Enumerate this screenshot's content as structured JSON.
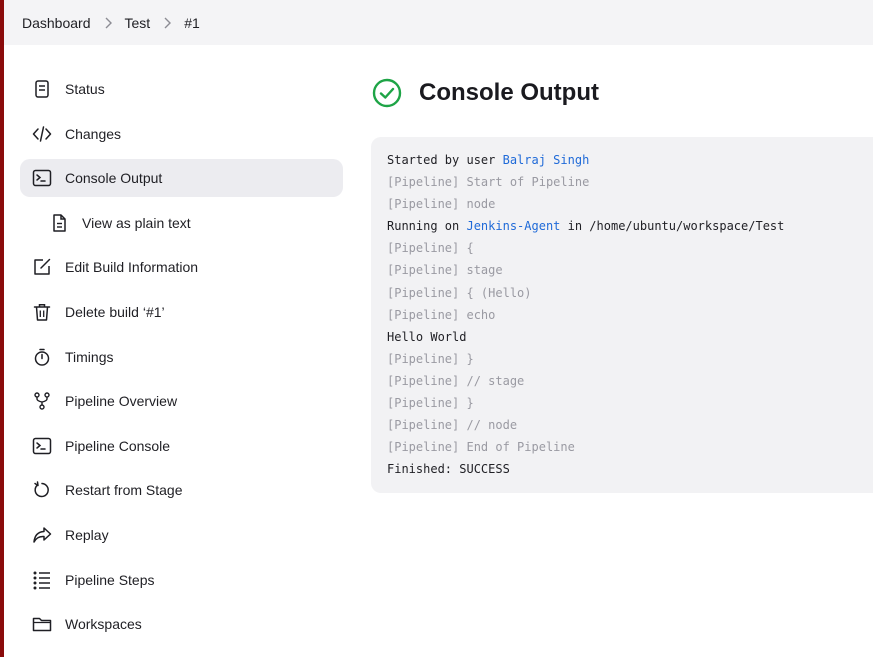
{
  "breadcrumb": [
    {
      "label": "Dashboard"
    },
    {
      "label": "Test"
    },
    {
      "label": "#1"
    }
  ],
  "sidebar": {
    "items": [
      {
        "label": "Status",
        "icon": "status-icon"
      },
      {
        "label": "Changes",
        "icon": "code-icon"
      },
      {
        "label": "Console Output",
        "icon": "terminal-icon",
        "active": true
      },
      {
        "label": "View as plain text",
        "icon": "document-icon",
        "sub": true
      },
      {
        "label": "Edit Build Information",
        "icon": "edit-icon"
      },
      {
        "label": "Delete build ‘#1’",
        "icon": "trash-icon"
      },
      {
        "label": "Timings",
        "icon": "stopwatch-icon"
      },
      {
        "label": "Pipeline Overview",
        "icon": "branch-icon"
      },
      {
        "label": "Pipeline Console",
        "icon": "terminal-icon"
      },
      {
        "label": "Restart from Stage",
        "icon": "restart-icon"
      },
      {
        "label": "Replay",
        "icon": "replay-icon"
      },
      {
        "label": "Pipeline Steps",
        "icon": "steps-icon"
      },
      {
        "label": "Workspaces",
        "icon": "folder-icon"
      }
    ]
  },
  "main": {
    "title": "Console Output",
    "status_icon": "success-check-icon",
    "status_color": "#1ea446"
  },
  "console": {
    "lines": [
      {
        "type": "normal",
        "parts": [
          {
            "text": "Started by user "
          },
          {
            "text": "Balraj Singh",
            "link": true
          }
        ]
      },
      {
        "type": "pipeline",
        "parts": [
          {
            "text": "[Pipeline] Start of Pipeline"
          }
        ]
      },
      {
        "type": "pipeline",
        "parts": [
          {
            "text": "[Pipeline] node"
          }
        ]
      },
      {
        "type": "normal",
        "parts": [
          {
            "text": "Running on "
          },
          {
            "text": "Jenkins-Agent",
            "link": true
          },
          {
            "text": " in /home/ubuntu/workspace/Test"
          }
        ]
      },
      {
        "type": "pipeline",
        "parts": [
          {
            "text": "[Pipeline] {"
          }
        ]
      },
      {
        "type": "pipeline",
        "parts": [
          {
            "text": "[Pipeline] stage"
          }
        ]
      },
      {
        "type": "pipeline",
        "parts": [
          {
            "text": "[Pipeline] { (Hello)"
          }
        ]
      },
      {
        "type": "pipeline",
        "parts": [
          {
            "text": "[Pipeline] echo"
          }
        ]
      },
      {
        "type": "normal",
        "parts": [
          {
            "text": "Hello World"
          }
        ]
      },
      {
        "type": "pipeline",
        "parts": [
          {
            "text": "[Pipeline] }"
          }
        ]
      },
      {
        "type": "pipeline",
        "parts": [
          {
            "text": "[Pipeline] // stage"
          }
        ]
      },
      {
        "type": "pipeline",
        "parts": [
          {
            "text": "[Pipeline] }"
          }
        ]
      },
      {
        "type": "pipeline",
        "parts": [
          {
            "text": "[Pipeline] // node"
          }
        ]
      },
      {
        "type": "pipeline",
        "parts": [
          {
            "text": "[Pipeline] End of Pipeline"
          }
        ]
      },
      {
        "type": "normal",
        "parts": [
          {
            "text": "Finished: SUCCESS"
          }
        ]
      }
    ]
  },
  "colors": {
    "accent_bar": "#8a0b0b",
    "link": "#1f6ad8",
    "active_bg": "#ececf0"
  }
}
